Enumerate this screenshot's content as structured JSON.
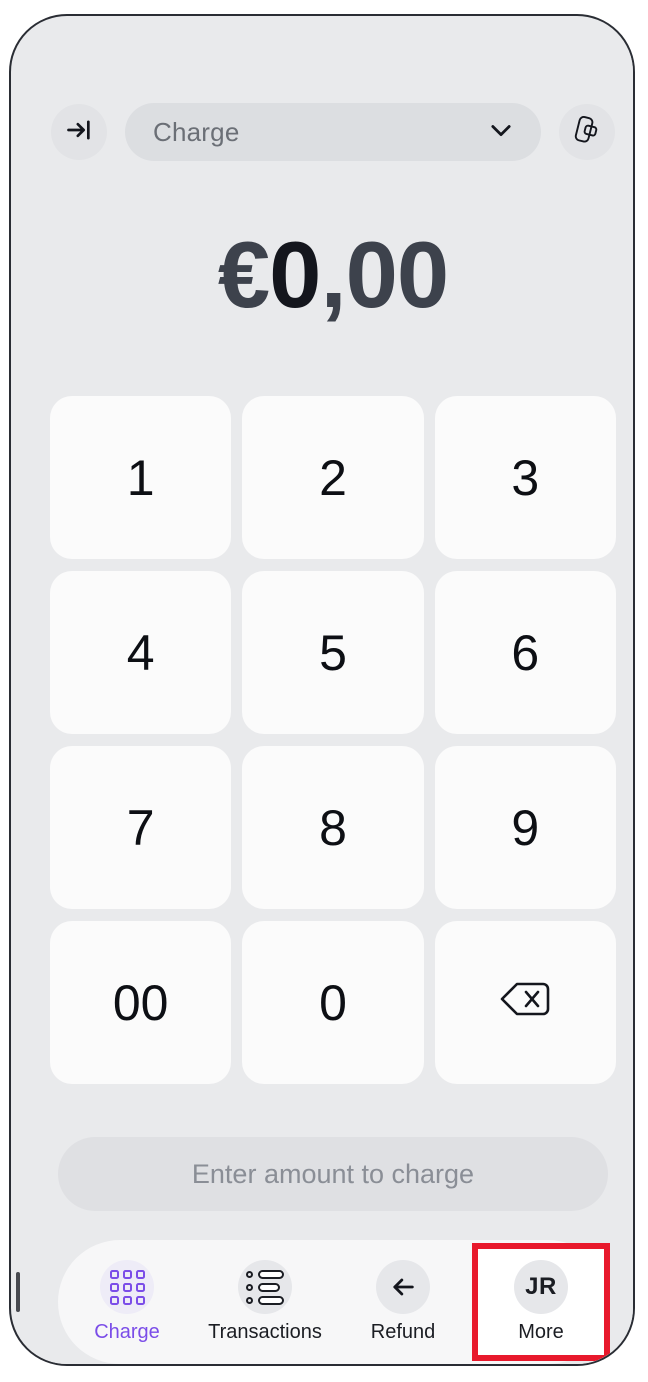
{
  "topbar": {
    "login_icon": "arrow-into-bar-icon",
    "mode_label": "Charge",
    "chevron_icon": "chevron-down-icon",
    "tap_to_pay_icon": "phone-card-icon"
  },
  "amount": {
    "currency": "€",
    "integer": "0",
    "separator": ",",
    "decimals": "00"
  },
  "keypad": {
    "keys": [
      {
        "label": "1",
        "name": "key-1"
      },
      {
        "label": "2",
        "name": "key-2"
      },
      {
        "label": "3",
        "name": "key-3"
      },
      {
        "label": "4",
        "name": "key-4"
      },
      {
        "label": "5",
        "name": "key-5"
      },
      {
        "label": "6",
        "name": "key-6"
      },
      {
        "label": "7",
        "name": "key-7"
      },
      {
        "label": "8",
        "name": "key-8"
      },
      {
        "label": "9",
        "name": "key-9"
      },
      {
        "label": "00",
        "name": "key-double-zero"
      },
      {
        "label": "0",
        "name": "key-0"
      },
      {
        "label": "",
        "name": "key-backspace"
      }
    ]
  },
  "cta": {
    "label": "Enter amount to charge",
    "enabled": false
  },
  "nav": {
    "items": [
      {
        "label": "Charge",
        "icon": "grid-icon",
        "active": true
      },
      {
        "label": "Transactions",
        "icon": "list-icon",
        "active": false
      },
      {
        "label": "Refund",
        "icon": "arrow-left-icon",
        "active": false
      },
      {
        "label": "More",
        "icon": "avatar-initials",
        "initials": "JR",
        "active": false
      }
    ]
  },
  "colors": {
    "accent": "#7b4de8",
    "highlight": "#e8192c",
    "screen_bg": "#e9eaec",
    "key_bg": "#fbfbfb"
  }
}
